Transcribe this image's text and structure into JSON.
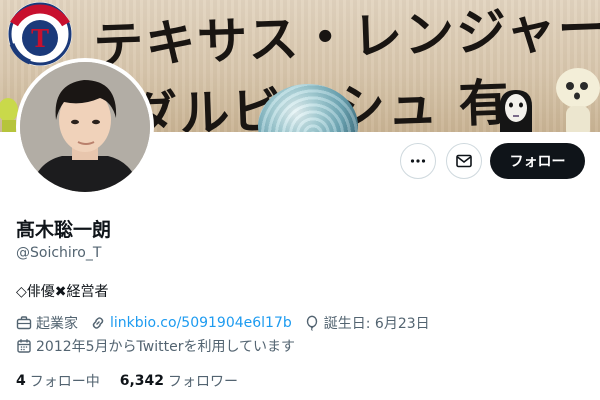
{
  "banner": {
    "headline_line1": "テキサス・レンジャーズ",
    "headline_line2": "ダルビッシュ 有"
  },
  "profile": {
    "display_name": "髙木聡一朗",
    "handle": "@Soichiro_T",
    "bio": "◇俳優✖経営者",
    "occupation": "起業家",
    "link": "linkbio.co/5091904e6l17b",
    "birthday": "誕生日: 6月23日",
    "joined": "2012年5月からTwitterを利用しています"
  },
  "actions": {
    "more_icon": "more-horizontal-icon",
    "message_icon": "mail-icon",
    "follow_label": "フォロー"
  },
  "stats": {
    "following_count": "4",
    "following_label": "フォロー中",
    "followers_count": "6,342",
    "followers_label": "フォロワー"
  },
  "colors": {
    "text_primary": "#0f1419",
    "text_secondary": "#536471",
    "link": "#1d9bf0",
    "follow_button_bg": "#0f1419",
    "border": "#cfd9de"
  }
}
